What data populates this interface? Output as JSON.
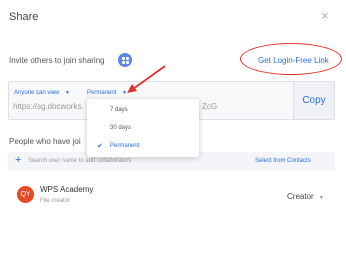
{
  "dialog": {
    "title": "Share",
    "close_glyph": "×"
  },
  "invite": {
    "text": "Invite others to join sharing",
    "badge_icon": "link-share-icon",
    "login_free_label": "Get Login-Free Link"
  },
  "link": {
    "permission_label": "Anyone can view",
    "permission_caret": "▼",
    "expiry_label": "Permanent",
    "expiry_caret": "▼",
    "url_start": "https://sg.docworks.",
    "url_end": "ZcG",
    "copy_label": "Copy"
  },
  "expiry_dropdown": {
    "options": [
      {
        "label": "7 days",
        "selected": false
      },
      {
        "label": "30 days",
        "selected": false
      },
      {
        "label": "Permanent",
        "selected": true
      }
    ],
    "check_glyph": "✔"
  },
  "people": {
    "heading": "People who have joi",
    "search_placeholder": "Search user name to add collaborators",
    "plus_glyph": "+",
    "from_contacts_label": "Select from Contacts"
  },
  "member": {
    "avatar_initials": "QY",
    "name": "WPS Academy",
    "subtitle": "File creator",
    "role": "Creator",
    "role_caret": "▼"
  },
  "colors": {
    "accent": "#2b6de0",
    "annotation_red": "#e2332b",
    "avatar": "#e24a2a"
  }
}
